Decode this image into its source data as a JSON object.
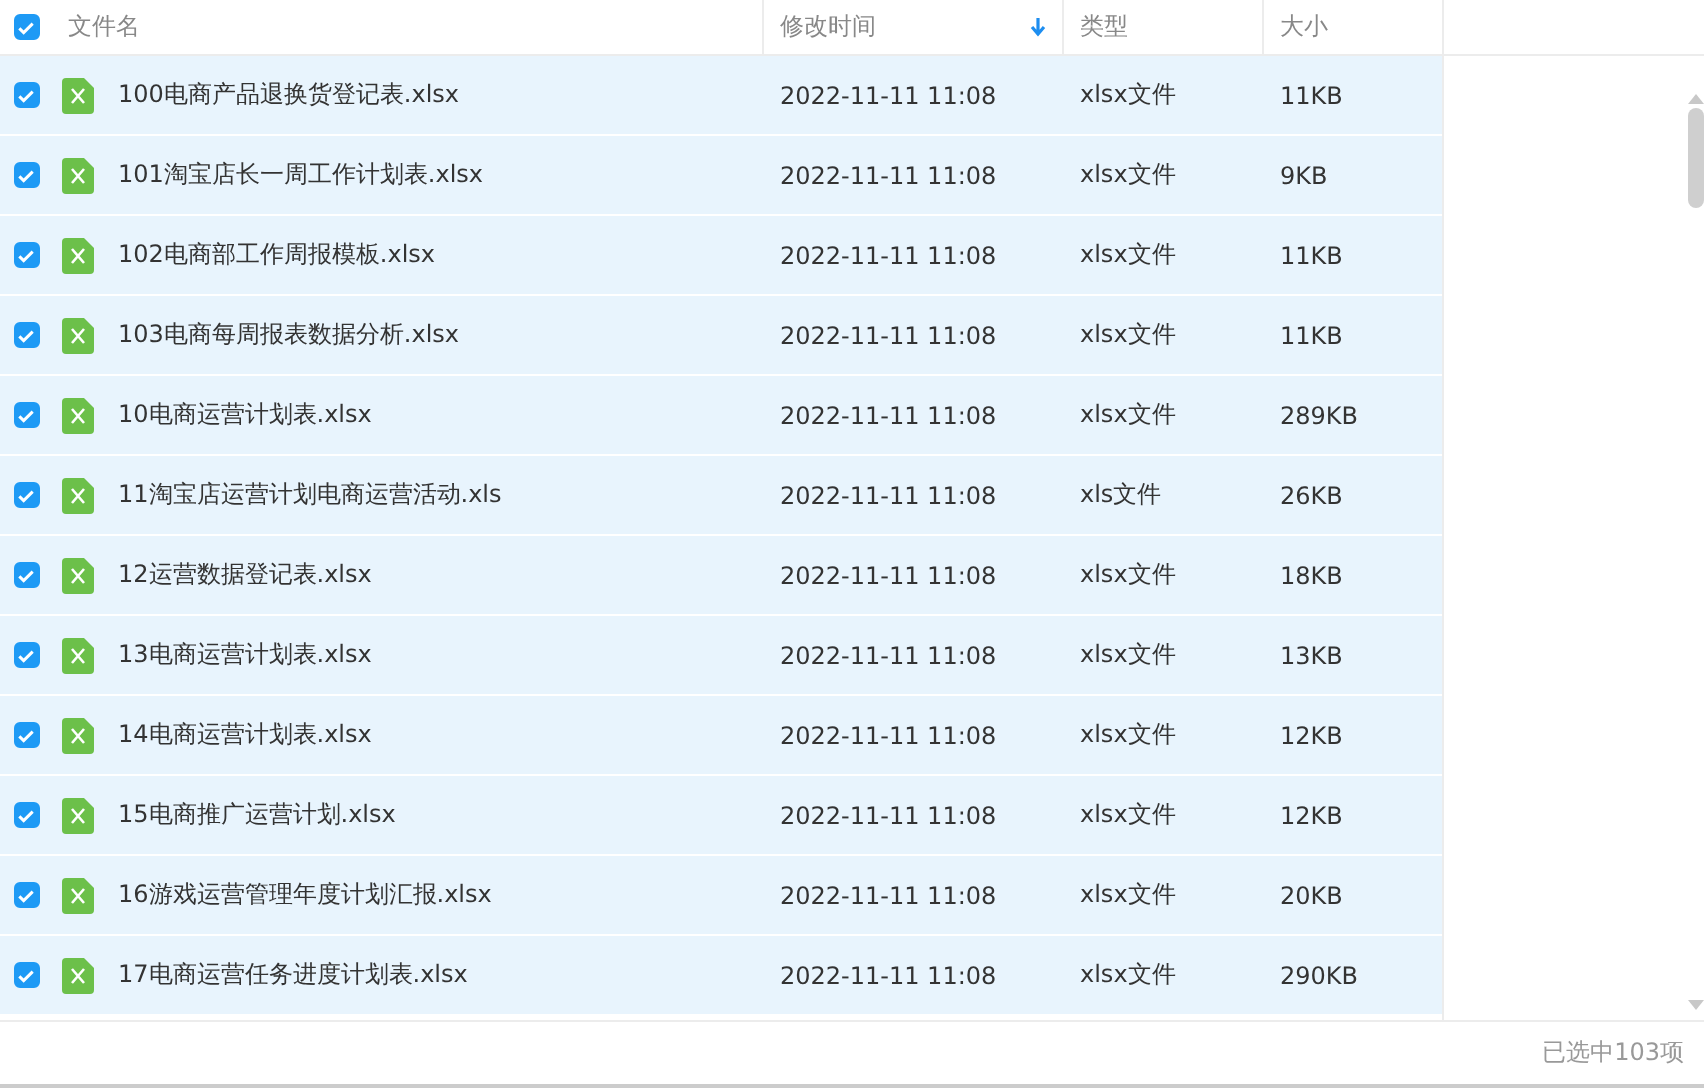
{
  "header": {
    "checked": true,
    "columns": [
      {
        "label": "文件名",
        "sorted": false
      },
      {
        "label": "修改时间",
        "sorted": true
      },
      {
        "label": "类型",
        "sorted": false
      },
      {
        "label": "大小",
        "sorted": false
      }
    ]
  },
  "rows": [
    {
      "checked": true,
      "name": "100电商产品退换货登记表.xlsx",
      "modified": "2022-11-11 11:08",
      "type": "xlsx文件",
      "size": "11KB"
    },
    {
      "checked": true,
      "name": "101淘宝店长一周工作计划表.xlsx",
      "modified": "2022-11-11 11:08",
      "type": "xlsx文件",
      "size": "9KB"
    },
    {
      "checked": true,
      "name": "102电商部工作周报模板.xlsx",
      "modified": "2022-11-11 11:08",
      "type": "xlsx文件",
      "size": "11KB"
    },
    {
      "checked": true,
      "name": "103电商每周报表数据分析.xlsx",
      "modified": "2022-11-11 11:08",
      "type": "xlsx文件",
      "size": "11KB"
    },
    {
      "checked": true,
      "name": "10电商运营计划表.xlsx",
      "modified": "2022-11-11 11:08",
      "type": "xlsx文件",
      "size": "289KB"
    },
    {
      "checked": true,
      "name": "11淘宝店运营计划电商运营活动.xls",
      "modified": "2022-11-11 11:08",
      "type": "xls文件",
      "size": "26KB"
    },
    {
      "checked": true,
      "name": "12运营数据登记表.xlsx",
      "modified": "2022-11-11 11:08",
      "type": "xlsx文件",
      "size": "18KB"
    },
    {
      "checked": true,
      "name": "13电商运营计划表.xlsx",
      "modified": "2022-11-11 11:08",
      "type": "xlsx文件",
      "size": "13KB"
    },
    {
      "checked": true,
      "name": "14电商运营计划表.xlsx",
      "modified": "2022-11-11 11:08",
      "type": "xlsx文件",
      "size": "12KB"
    },
    {
      "checked": true,
      "name": "15电商推广运营计划.xlsx",
      "modified": "2022-11-11 11:08",
      "type": "xlsx文件",
      "size": "12KB"
    },
    {
      "checked": true,
      "name": "16游戏运营管理年度计划汇报.xlsx",
      "modified": "2022-11-11 11:08",
      "type": "xlsx文件",
      "size": "20KB"
    },
    {
      "checked": true,
      "name": "17电商运营任务进度计划表.xlsx",
      "modified": "2022-11-11 11:08",
      "type": "xlsx文件",
      "size": "290KB"
    }
  ],
  "status": "已选中103项"
}
